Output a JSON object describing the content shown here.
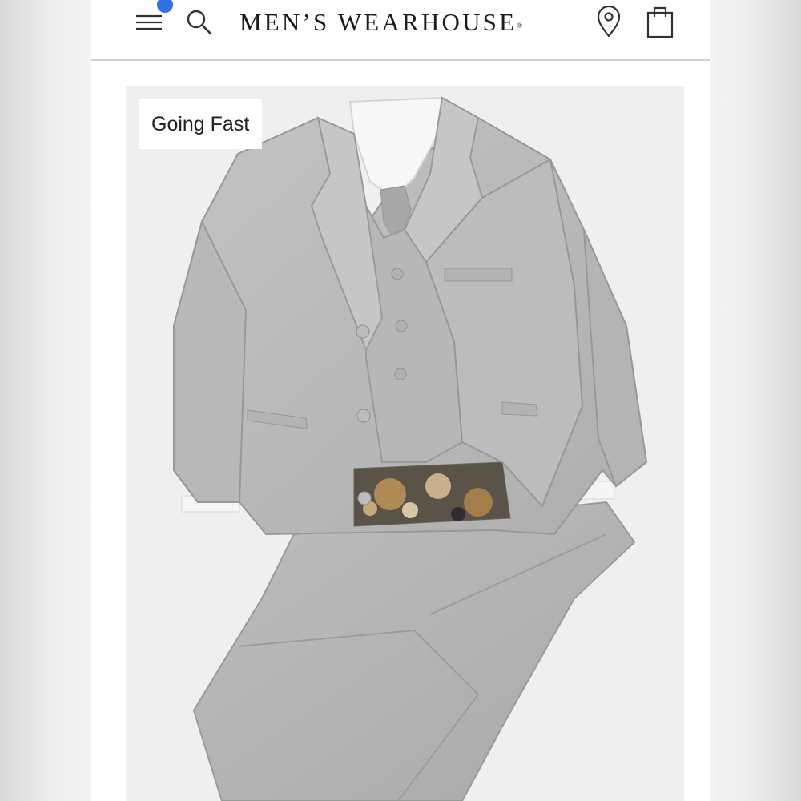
{
  "header": {
    "brand_name": "MEN’S WEARHOUSE",
    "brand_mark": "®",
    "icons": {
      "menu": "hamburger-menu-icon",
      "notification": "notification-dot",
      "search": "search-icon",
      "location": "location-pin-icon",
      "bag": "shopping-bag-icon"
    },
    "notification_color": "#2f6fe8"
  },
  "product": {
    "badge_label": "Going Fast",
    "image_alt": "Light gray boys suit with vest, tie, white shirt and paisley cummerbund",
    "suit_color": "#b9b9b9"
  }
}
